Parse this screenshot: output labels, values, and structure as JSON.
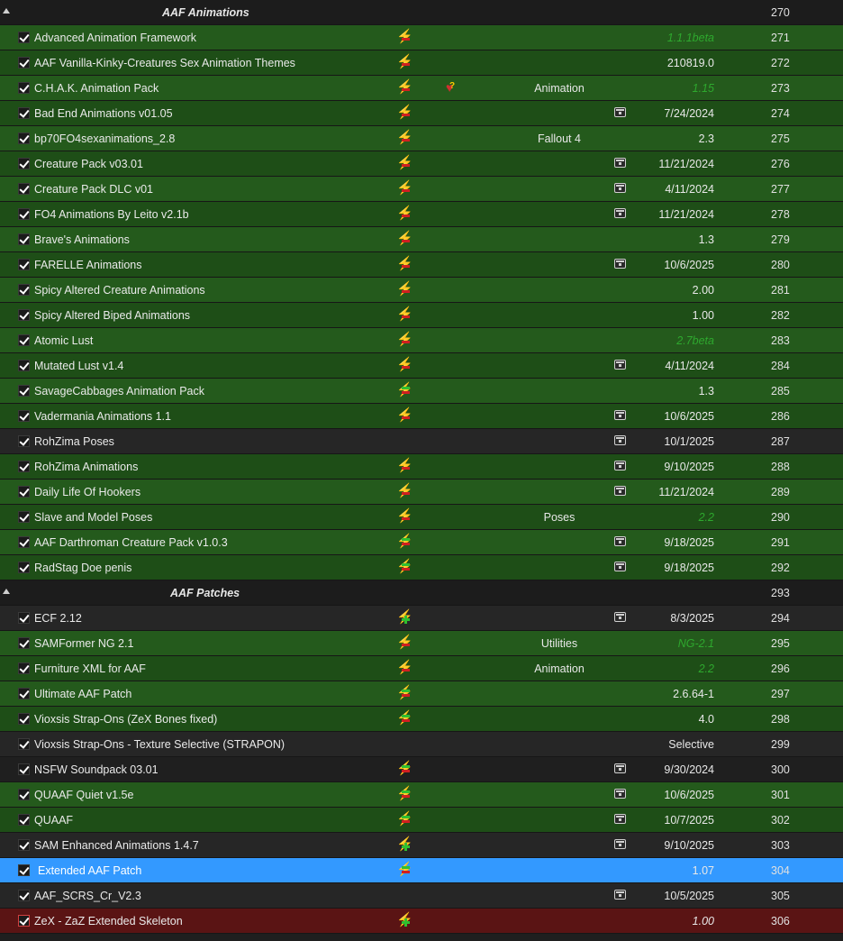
{
  "mod_list": {
    "rows": [
      {
        "kind": "separator",
        "title": "AAF Animations",
        "title_indent": 180,
        "priority": "270"
      },
      {
        "kind": "mod",
        "name": "Advanced Animation Framework",
        "flag": "red",
        "category": "",
        "nexus": false,
        "version": "1.1.1beta",
        "version_style": "outdated",
        "priority": "271",
        "bg": "even"
      },
      {
        "kind": "mod",
        "name": "AAF Vanilla-Kinky-Creatures Sex Animation Themes",
        "flag": "red",
        "category": "",
        "nexus": false,
        "version": "210819.0",
        "priority": "272",
        "bg": "odd"
      },
      {
        "kind": "mod",
        "name": "C.H.A.K. Animation Pack",
        "flag": "red",
        "heart": true,
        "category": "Animation",
        "nexus": false,
        "version": "1.15",
        "version_style": "outdated",
        "priority": "273",
        "bg": "even"
      },
      {
        "kind": "mod",
        "name": "Bad End Animations v01.05",
        "flag": "red",
        "category": "",
        "nexus": true,
        "version": "7/24/2024",
        "priority": "274",
        "bg": "odd"
      },
      {
        "kind": "mod",
        "name": "bp70FO4sexanimations_2.8",
        "flag": "red",
        "category": "Fallout 4",
        "nexus": false,
        "version": "2.3",
        "priority": "275",
        "bg": "even"
      },
      {
        "kind": "mod",
        "name": "Creature Pack v03.01",
        "flag": "red",
        "category": "",
        "nexus": true,
        "version": "11/21/2024",
        "priority": "276",
        "bg": "odd"
      },
      {
        "kind": "mod",
        "name": "Creature Pack DLC v01",
        "flag": "red",
        "category": "",
        "nexus": true,
        "version": "4/11/2024",
        "priority": "277",
        "bg": "even"
      },
      {
        "kind": "mod",
        "name": "FO4 Animations By Leito v2.1b",
        "flag": "red",
        "category": "",
        "nexus": true,
        "version": "11/21/2024",
        "priority": "278",
        "bg": "odd"
      },
      {
        "kind": "mod",
        "name": "Brave's Animations",
        "flag": "red",
        "category": "",
        "nexus": false,
        "version": "1.3",
        "priority": "279",
        "bg": "even"
      },
      {
        "kind": "mod",
        "name": "FARELLE Animations",
        "flag": "red",
        "category": "",
        "nexus": true,
        "version": "10/6/2025",
        "priority": "280",
        "bg": "odd"
      },
      {
        "kind": "mod",
        "name": "Spicy Altered Creature Animations",
        "flag": "red",
        "category": "",
        "nexus": false,
        "version": "2.00",
        "priority": "281",
        "bg": "even"
      },
      {
        "kind": "mod",
        "name": "Spicy Altered Biped Animations",
        "flag": "red",
        "category": "",
        "nexus": false,
        "version": "1.00",
        "priority": "282",
        "bg": "odd"
      },
      {
        "kind": "mod",
        "name": "Atomic Lust",
        "flag": "red",
        "category": "",
        "nexus": false,
        "version": "2.7beta",
        "version_style": "outdated",
        "priority": "283",
        "bg": "even"
      },
      {
        "kind": "mod",
        "name": "Mutated Lust v1.4",
        "flag": "red",
        "category": "",
        "nexus": true,
        "version": "4/11/2024",
        "priority": "284",
        "bg": "odd"
      },
      {
        "kind": "mod",
        "name": "SavageCabbages Animation Pack",
        "flag": "both",
        "category": "",
        "nexus": false,
        "version": "1.3",
        "priority": "285",
        "bg": "even"
      },
      {
        "kind": "mod",
        "name": "Vadermania Animations 1.1",
        "flag": "red",
        "category": "",
        "nexus": true,
        "version": "10/6/2025",
        "priority": "286",
        "bg": "odd"
      },
      {
        "kind": "mod",
        "name": "RohZima Poses",
        "flag": "none",
        "category": "",
        "nexus": true,
        "version": "10/1/2025",
        "priority": "287",
        "bg": "dark-even"
      },
      {
        "kind": "mod",
        "name": "RohZima Animations",
        "flag": "red",
        "category": "",
        "nexus": true,
        "version": "9/10/2025",
        "priority": "288",
        "bg": "odd"
      },
      {
        "kind": "mod",
        "name": "Daily Life Of Hookers",
        "flag": "red",
        "category": "",
        "nexus": true,
        "version": "11/21/2024",
        "priority": "289",
        "bg": "even"
      },
      {
        "kind": "mod",
        "name": "Slave and Model Poses",
        "flag": "red",
        "category": "Poses",
        "nexus": false,
        "version": "2.2",
        "version_style": "outdated",
        "priority": "290",
        "bg": "odd"
      },
      {
        "kind": "mod",
        "name": "AAF Darthroman Creature Pack v1.0.3",
        "flag": "both",
        "category": "",
        "nexus": true,
        "version": "9/18/2025",
        "priority": "291",
        "bg": "even"
      },
      {
        "kind": "mod",
        "name": "RadStag Doe penis",
        "flag": "both",
        "category": "",
        "nexus": true,
        "version": "9/18/2025",
        "priority": "292",
        "bg": "odd"
      },
      {
        "kind": "separator",
        "title": "AAF Patches",
        "title_indent": 189,
        "priority": "293"
      },
      {
        "kind": "mod",
        "name": "ECF 2.12",
        "flag": "plus",
        "category": "",
        "nexus": true,
        "version": "8/3/2025",
        "priority": "294",
        "bg": "dark-even"
      },
      {
        "kind": "mod",
        "name": "SAMFormer NG 2.1",
        "flag": "red",
        "category": "Utilities",
        "nexus": false,
        "version": "NG-2.1",
        "version_style": "outdated",
        "priority": "295",
        "bg": "even"
      },
      {
        "kind": "mod",
        "name": "Furniture XML for AAF",
        "flag": "red",
        "category": "Animation",
        "nexus": false,
        "version": "2.2",
        "version_style": "outdated",
        "priority": "296",
        "bg": "odd"
      },
      {
        "kind": "mod",
        "name": "Ultimate AAF Patch",
        "flag": "both",
        "category": "",
        "nexus": false,
        "version": "2.6.64-1",
        "priority": "297",
        "bg": "even"
      },
      {
        "kind": "mod",
        "name": "Vioxsis Strap-Ons (ZeX Bones fixed)",
        "flag": "both",
        "category": "",
        "nexus": false,
        "version": "4.0",
        "priority": "298",
        "bg": "odd"
      },
      {
        "kind": "mod",
        "name": "Vioxsis Strap-Ons - Texture Selective (STRAPON)",
        "flag": "none",
        "category": "",
        "nexus": false,
        "version": "Selective",
        "priority": "299",
        "bg": "dark-even"
      },
      {
        "kind": "mod",
        "name": "NSFW Soundpack 03.01",
        "flag": "both",
        "category": "",
        "nexus": true,
        "version": "9/30/2024",
        "priority": "300",
        "bg": "dark-odd"
      },
      {
        "kind": "mod",
        "name": "QUAAF Quiet v1.5e",
        "flag": "both",
        "category": "",
        "nexus": true,
        "version": "10/6/2025",
        "priority": "301",
        "bg": "even"
      },
      {
        "kind": "mod",
        "name": "QUAAF",
        "flag": "both",
        "category": "",
        "nexus": true,
        "version": "10/7/2025",
        "priority": "302",
        "bg": "odd"
      },
      {
        "kind": "mod",
        "name": "SAM Enhanced Animations 1.4.7",
        "flag": "plus",
        "category": "",
        "nexus": true,
        "version": "9/10/2025",
        "priority": "303",
        "bg": "dark-even"
      },
      {
        "kind": "mod",
        "name": "Extended AAF Patch",
        "flag": "both",
        "category": "",
        "nexus": false,
        "version": "1.07",
        "priority": "304",
        "bg": "selected"
      },
      {
        "kind": "mod",
        "name": "AAF_SCRS_Cr_V2.3",
        "flag": "none",
        "category": "",
        "nexus": true,
        "version": "10/5/2025",
        "priority": "305",
        "bg": "dark-even"
      },
      {
        "kind": "mod",
        "name": "ZeX - ZaZ Extended Skeleton",
        "flag": "plus",
        "category": "",
        "nexus": false,
        "version": "1.00",
        "version_style": "conflict-ver",
        "priority": "306",
        "bg": "conflict"
      }
    ]
  },
  "icons": {
    "collapse": "collapse-triangle-icon",
    "flag": "conflict-lightning-icon",
    "heart": "endorsement-unknown-icon",
    "nexus": "nexus-mod-icon",
    "check": "checkbox-checked-icon"
  }
}
